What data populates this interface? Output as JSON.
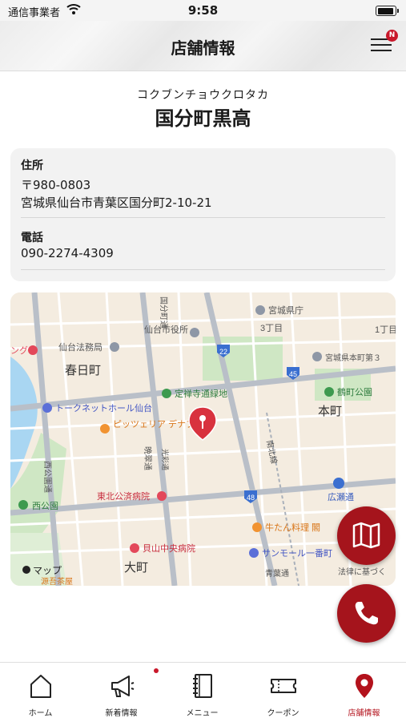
{
  "status_bar": {
    "carrier": "通信事業者",
    "time": "9:58"
  },
  "header": {
    "title": "店舗情報",
    "menu_badge": "N"
  },
  "store": {
    "name_kana": "コクブンチョウクロタカ",
    "name": "国分町黒高",
    "address_label": "住所",
    "postal": "〒980-0803",
    "address": "宮城県仙台市青葉区国分町2-10-21",
    "phone_label": "電話",
    "phone": "090-2274-4309"
  },
  "map": {
    "attribution": "マップ",
    "labels": {
      "pref_office": "宮城県庁",
      "chome3": "3丁目",
      "chome1": "1丁目",
      "kokubuncho_dori": "国分町通",
      "city_hall": "仙台市役所",
      "court": "仙台法務局",
      "kasuga": "春日町",
      "honcho3": "宮城県本町第３",
      "route22": "22",
      "route45": "45",
      "route48": "48",
      "jozenji": "定禅寺通緑地",
      "tsutsumi": "鶴町公園",
      "tokunet": "トークネットホール仙台",
      "honcho": "本町",
      "pizzeria": "ピッツェリア デナプレ",
      "bansui": "晩翠通",
      "hikari": "光彩通",
      "nishi_dori": "西公園通",
      "nishi_park": "西公園",
      "tohoku_hosp": "東北公済病院",
      "hirose": "広瀬通",
      "gyutan": "牛たん料理 閣",
      "kaiyama": "貝山中央病院",
      "sunmall": "サンモール一番町",
      "omachi": "大町",
      "aoba": "青葉通",
      "hosei": "法律に基づく",
      "minenko": "源吾茶屋",
      "edge_left": "ング",
      "minami_dori": "南北線"
    }
  },
  "tabs": [
    {
      "label": "ホーム",
      "icon": "home-icon"
    },
    {
      "label": "新着情報",
      "icon": "megaphone-icon"
    },
    {
      "label": "メニュー",
      "icon": "book-icon"
    },
    {
      "label": "クーポン",
      "icon": "ticket-icon"
    },
    {
      "label": "店舗情報",
      "icon": "location-pin-icon"
    }
  ],
  "colors": {
    "accent": "#a5141c",
    "badge": "#c9182b"
  }
}
